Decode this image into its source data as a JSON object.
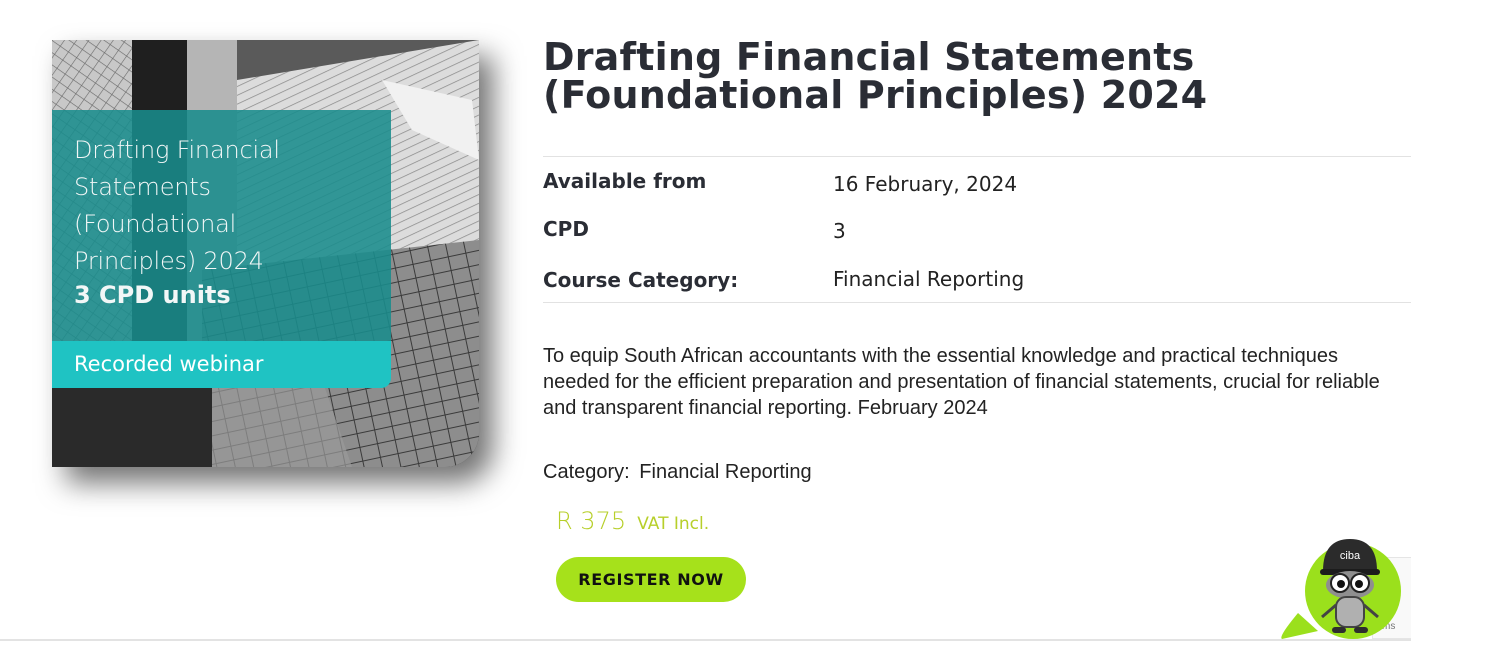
{
  "course_image": {
    "title_lines": [
      "Drafting Financial",
      "Statements (Foundational",
      "Principles) 2024"
    ],
    "units": "3 CPD units",
    "format": "Recorded webinar"
  },
  "course": {
    "title": "Drafting Financial Statements (Foundational Principles) 2024",
    "meta": [
      {
        "label": "Available from",
        "value": "16 February, 2024"
      },
      {
        "label": "CPD",
        "value": "3"
      },
      {
        "label": "Course Category:",
        "value": "Financial Reporting"
      }
    ],
    "description": "To equip South African accountants with the essential knowledge and practical techniques needed for the efficient preparation and presentation of financial statements, crucial for reliable and transparent financial reporting. February 2024",
    "category_label": "Category:",
    "category_value": "Financial Reporting",
    "price": "R 375",
    "price_note": "VAT Incl.",
    "register_label": "REGISTER NOW"
  },
  "chat_widget": {
    "icon": "ciba-mascot-icon",
    "brand": "ciba",
    "recaptcha_fragment": "ms"
  },
  "colors": {
    "teal": "#198c8c",
    "cyan": "#1fc3c3",
    "price": "#b7cf2a",
    "button": "#a6e11b",
    "mascot_green": "#9be01c"
  }
}
